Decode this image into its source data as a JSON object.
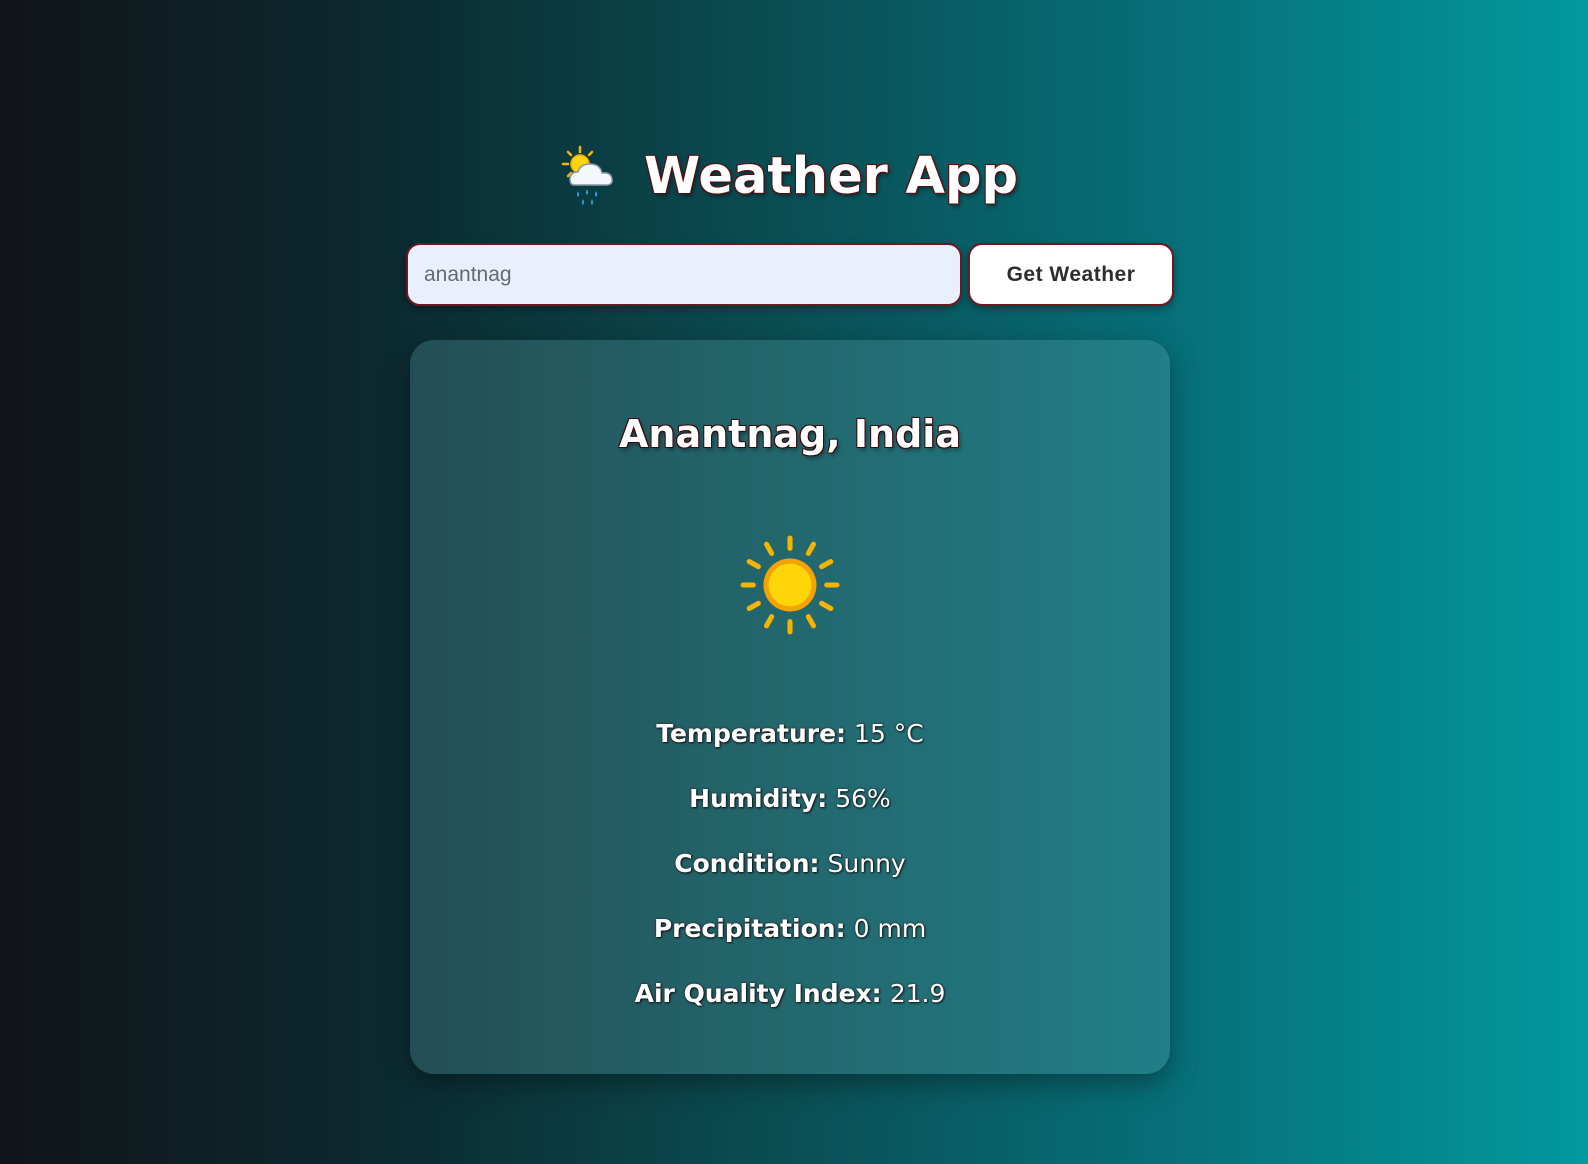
{
  "app": {
    "title": "Weather App",
    "title_icon": "sun-behind-rain-cloud-icon"
  },
  "search": {
    "value": "anantnag",
    "button_label": "Get Weather"
  },
  "result": {
    "location": "Anantnag, India",
    "condition_icon": "sun-icon",
    "details": [
      {
        "label": "Temperature:",
        "value": "15 °C"
      },
      {
        "label": "Humidity:",
        "value": "56%"
      },
      {
        "label": "Condition:",
        "value": "Sunny"
      },
      {
        "label": "Precipitation:",
        "value": "0 mm"
      },
      {
        "label": "Air Quality Index:",
        "value": "21.9"
      }
    ]
  },
  "colors": {
    "background_start": "#111418",
    "background_end": "#02999f",
    "input_background": "#e9f0fb",
    "sun_yellow": "#ffd60a",
    "sun_orange": "#f5a300"
  }
}
